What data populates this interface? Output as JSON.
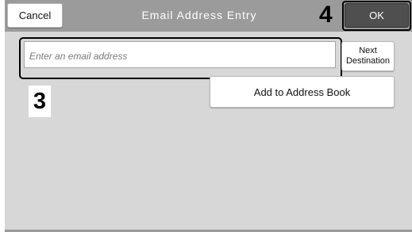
{
  "header": {
    "cancel_label": "Cancel",
    "title": "Email Address Entry",
    "ok_label": "OK"
  },
  "email_input": {
    "placeholder": "Enter an email address",
    "value": ""
  },
  "next_destination": {
    "line1": "Next",
    "line2": "Destination"
  },
  "add_to_address_book_label": "Add to Address Book",
  "callouts": {
    "input": "3",
    "ok": "4"
  },
  "colors": {
    "top_bar": "#9b9b9b",
    "screen_bg": "#d7d7d7",
    "ok_button": "#4f4f4f"
  }
}
